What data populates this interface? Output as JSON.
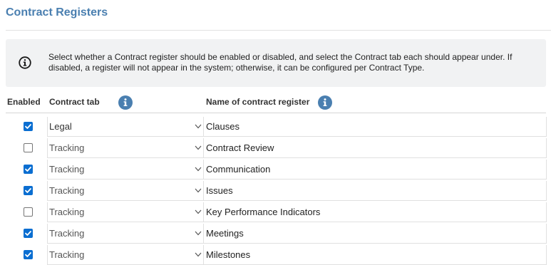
{
  "page_title": "Contract Registers",
  "info_text": "Select whether a Contract register should be enabled or disabled, and select the Contract tab each should appear under. If disabled, a register will not appear in the system; otherwise, it can be configured per Contract Type.",
  "headers": {
    "enabled": "Enabled",
    "contract_tab": "Contract tab",
    "register_name": "Name of contract register"
  },
  "colors": {
    "title": "#4a7fb0",
    "info_icon": "#4a7fb0",
    "checkbox_checked": "#0a6ed1"
  },
  "rows": [
    {
      "enabled": true,
      "tab": "Legal",
      "name": "Clauses"
    },
    {
      "enabled": false,
      "tab": "Tracking",
      "name": "Contract Review"
    },
    {
      "enabled": true,
      "tab": "Tracking",
      "name": "Communication"
    },
    {
      "enabled": true,
      "tab": "Tracking",
      "name": "Issues"
    },
    {
      "enabled": false,
      "tab": "Tracking",
      "name": "Key Performance Indicators"
    },
    {
      "enabled": true,
      "tab": "Tracking",
      "name": "Meetings"
    },
    {
      "enabled": true,
      "tab": "Tracking",
      "name": "Milestones"
    }
  ]
}
